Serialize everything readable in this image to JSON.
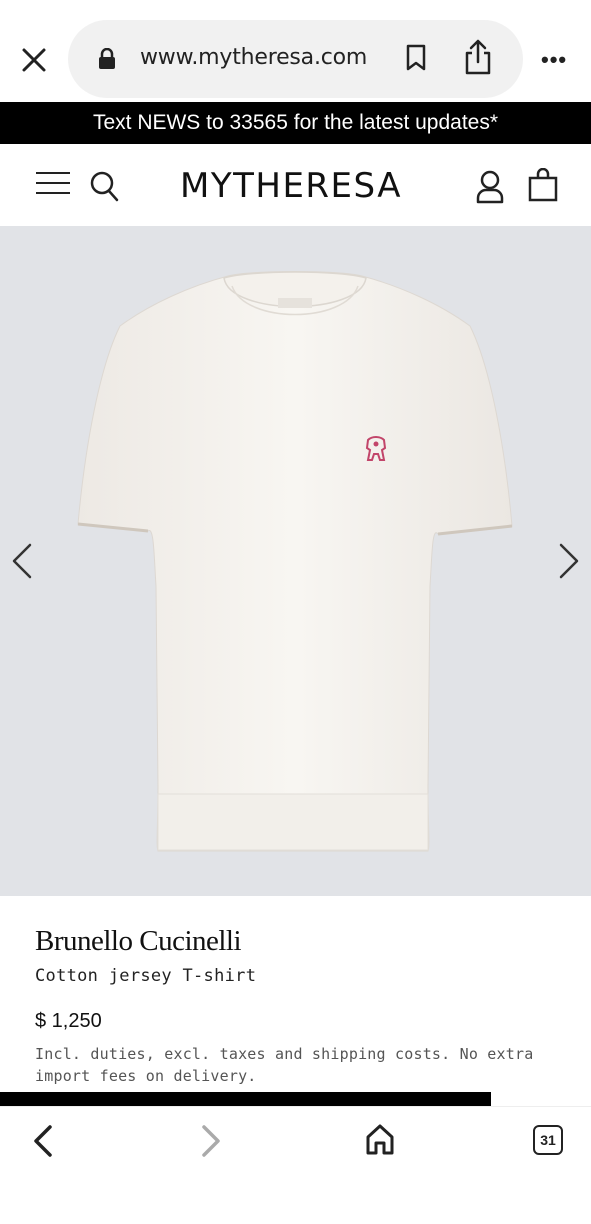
{
  "browser": {
    "url": "www.mytheresa.com"
  },
  "promo": {
    "text": "Text NEWS to 33565 for the latest updates*"
  },
  "header": {
    "logo": "MYTHERESA"
  },
  "product": {
    "brand": "Brunello Cucinelli",
    "name": "Cotton jersey T-shirt",
    "price": "$ 1,250",
    "note": "Incl. duties, excl. taxes and shipping costs. No extra import fees on delivery."
  },
  "progress": 0.83,
  "bottom_nav": {
    "tabs_count": "31"
  },
  "colors": {
    "gallery_bg": "#e1e3e7",
    "shirt": "#f6f3ef",
    "logo_embroidery": "#c2456a"
  },
  "icons": [
    "close-icon",
    "lock-icon",
    "bookmark-icon",
    "share-icon",
    "more-icon",
    "menu-icon",
    "search-icon",
    "account-icon",
    "bag-icon",
    "chevron-left-icon",
    "chevron-right-icon",
    "back-icon",
    "forward-icon",
    "home-icon",
    "tabs-icon"
  ]
}
